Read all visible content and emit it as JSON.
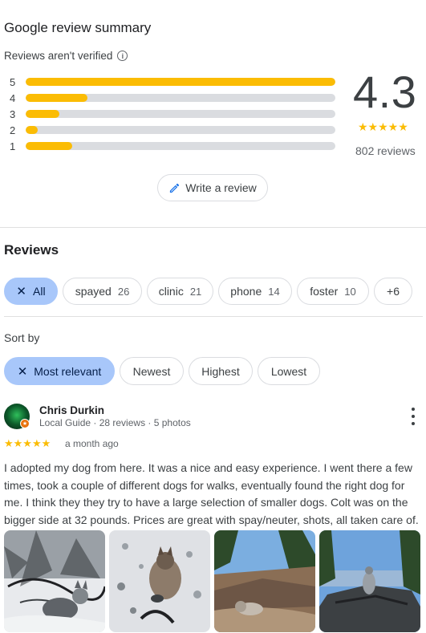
{
  "summary": {
    "title": "Google review summary",
    "unverified_label": "Reviews aren't verified",
    "rating": "4.3",
    "stars": "★★★★★",
    "review_count": "802 reviews",
    "write_review_label": "Write a review",
    "distribution": [
      {
        "stars": "5",
        "fraction": 1.0
      },
      {
        "stars": "4",
        "fraction": 0.2
      },
      {
        "stars": "3",
        "fraction": 0.11
      },
      {
        "stars": "2",
        "fraction": 0.04
      },
      {
        "stars": "1",
        "fraction": 0.15
      }
    ]
  },
  "reviews_section": {
    "heading": "Reviews",
    "topic_chips": [
      {
        "label": "All",
        "count": ""
      },
      {
        "label": "spayed",
        "count": "26"
      },
      {
        "label": "clinic",
        "count": "21"
      },
      {
        "label": "phone",
        "count": "14"
      },
      {
        "label": "foster",
        "count": "10"
      },
      {
        "label": "+6",
        "count": ""
      }
    ],
    "sort_label": "Sort by",
    "sort_options": [
      "Most relevant",
      "Newest",
      "Highest",
      "Lowest"
    ]
  },
  "review": {
    "author": "Chris Durkin",
    "meta": "Local Guide · 28 reviews · 5 photos",
    "stars": "★★★★★",
    "when": "a month ago",
    "text": "I adopted my dog from here. It was a nice and easy experience. I went there a few times, took a couple of different dogs for walks, eventually found the right dog for me. I think they they try to have a large selection of smaller dogs. Colt was on the bigger side at 32 pounds. Prices are great with spay/neuter, shots, all taken care of."
  },
  "colors": {
    "star_yellow": "#fbbc04",
    "selected_chip": "#a8c7fa",
    "accent_blue": "#1a73e8"
  }
}
